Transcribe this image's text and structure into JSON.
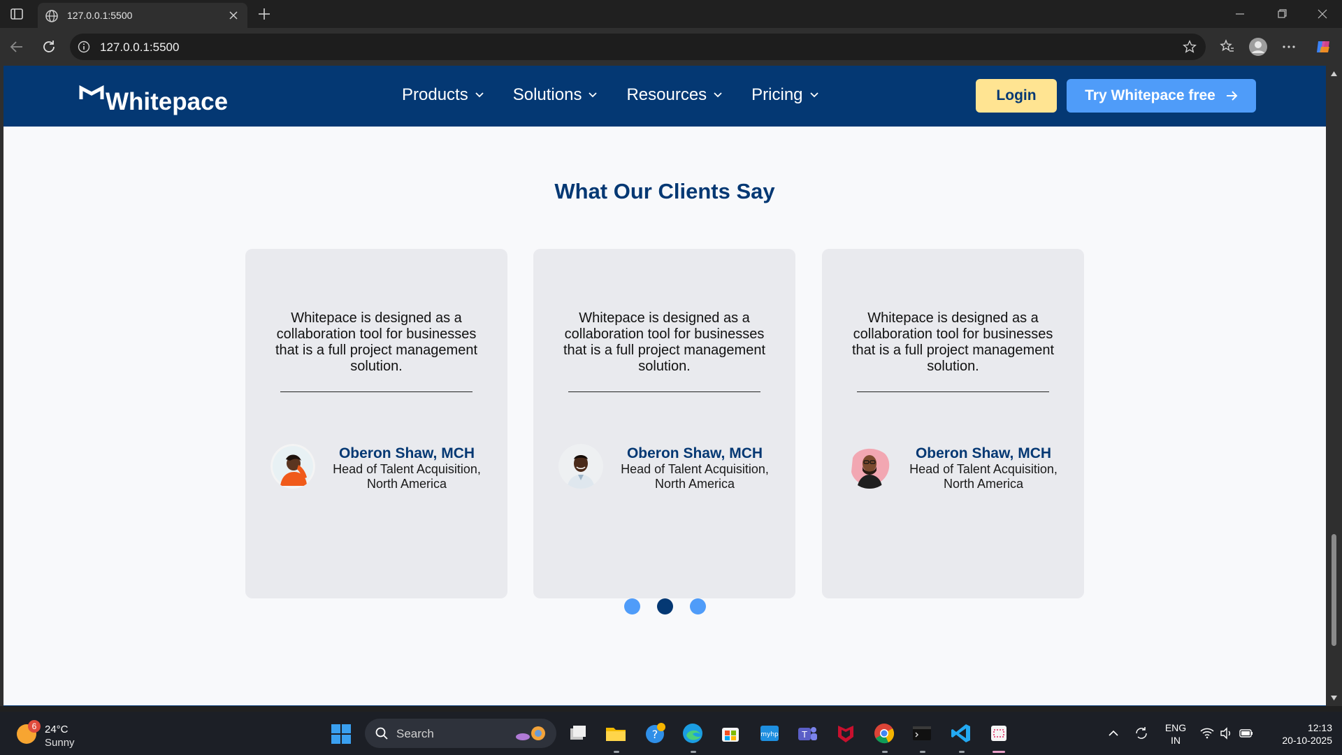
{
  "browser": {
    "tab_title": "127.0.0.1:5500",
    "url": "127.0.0.1:5500"
  },
  "site": {
    "logo_text": "Whitepace",
    "nav": [
      {
        "label": "Products"
      },
      {
        "label": "Solutions"
      },
      {
        "label": "Resources"
      },
      {
        "label": "Pricing"
      }
    ],
    "login_label": "Login",
    "try_label": "Try Whitepace free"
  },
  "testimonials": {
    "title": "What Our Clients Say",
    "cards": [
      {
        "quote": "Whitepace is designed as a collaboration tool for businesses that is a full project management solution.",
        "name": "Oberon Shaw, MCH",
        "role": "Head of Talent Acquisition, North America",
        "avatar": "woman-orange-avatar"
      },
      {
        "quote": "Whitepace is designed as a collaboration tool for businesses that is a full project management solution.",
        "name": "Oberon Shaw, MCH",
        "role": "Head of Talent Acquisition, North America",
        "avatar": "man-white-shirt-avatar"
      },
      {
        "quote": "Whitepace is designed as a collaboration tool for businesses that is a full project management solution.",
        "name": "Oberon Shaw, MCH",
        "role": "Head of Talent Acquisition, North America",
        "avatar": "man-pink-bg-avatar"
      }
    ],
    "active_dot": 1
  },
  "taskbar": {
    "weather_badge": "6",
    "weather_temp": "24°C",
    "weather_desc": "Sunny",
    "search_label": "Search",
    "lang_line1": "ENG",
    "lang_line2": "IN",
    "time": "12:13",
    "date": "20-10-2025"
  },
  "colors": {
    "brand_navy": "#043873",
    "brand_blue": "#4f9cf9",
    "login_yellow": "#ffe492",
    "card_bg": "#e9eaee"
  }
}
